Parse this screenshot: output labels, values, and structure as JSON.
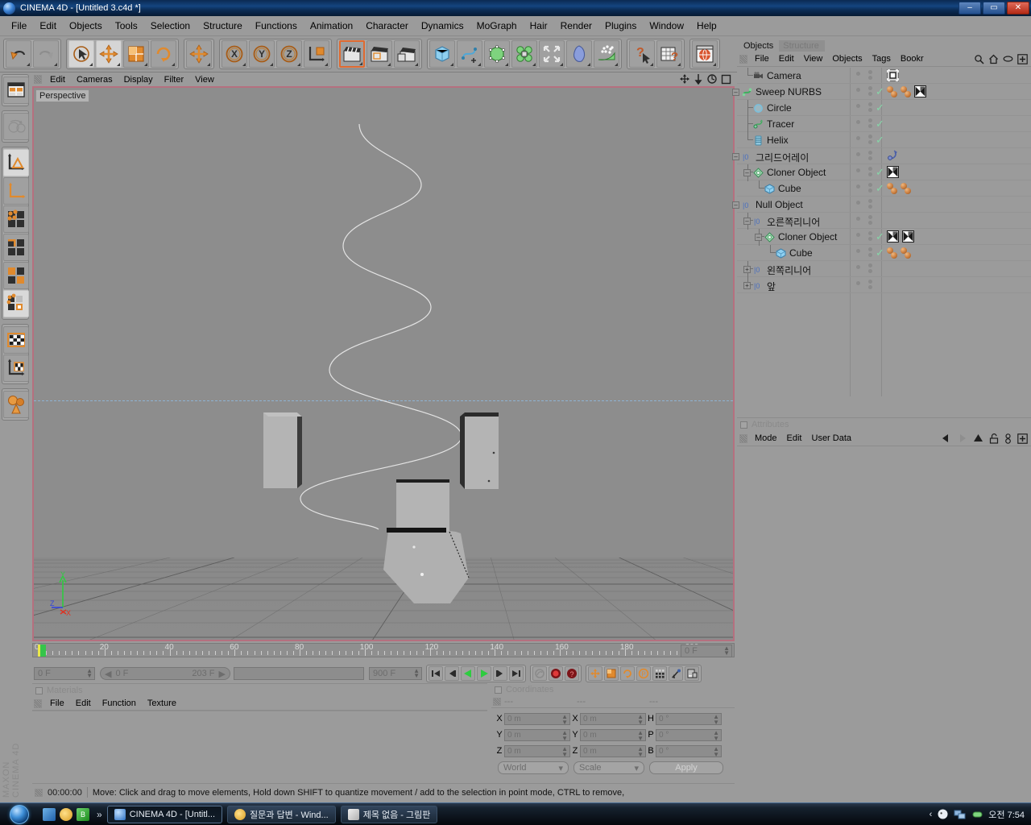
{
  "window": {
    "title": "CINEMA 4D - [Untitled 3.c4d *]",
    "minimize": "–",
    "maximize": "▭",
    "close": "✕"
  },
  "menubar": {
    "items": [
      "File",
      "Edit",
      "Objects",
      "Tools",
      "Selection",
      "Structure",
      "Functions",
      "Animation",
      "Character",
      "Dynamics",
      "MoGraph",
      "Hair",
      "Render",
      "Plugins",
      "Window",
      "Help"
    ]
  },
  "toolbar": {
    "groups": [
      {
        "buttons": [
          {
            "name": "undo-button",
            "icon": "undo"
          },
          {
            "name": "redo-button",
            "icon": "redo"
          }
        ]
      },
      {
        "buttons": [
          {
            "name": "live-selection-tool",
            "icon": "select-cursor",
            "state": "selected"
          },
          {
            "name": "move-tool",
            "icon": "move-arrows",
            "state": "selected"
          },
          {
            "name": "scale-tool",
            "icon": "scale-box"
          },
          {
            "name": "rotate-tool",
            "icon": "rotate-arrows"
          }
        ]
      },
      {
        "buttons": [
          {
            "name": "world-object-axis-tool",
            "icon": "move-arrows"
          }
        ]
      },
      {
        "buttons": [
          {
            "name": "lock-x-axis-button",
            "icon": "axis-x",
            "label": "X"
          },
          {
            "name": "lock-y-axis-button",
            "icon": "axis-y",
            "label": "Y"
          },
          {
            "name": "lock-z-axis-button",
            "icon": "axis-z",
            "label": "Z"
          },
          {
            "name": "world-coordinate-system-button",
            "icon": "axis-cube"
          }
        ]
      },
      {
        "buttons": [
          {
            "name": "render-view-button",
            "icon": "clapper-orange",
            "state": "highlight"
          },
          {
            "name": "render-region-button",
            "icon": "clapper-region"
          },
          {
            "name": "render-settings-button",
            "icon": "clapper-settings"
          }
        ]
      },
      {
        "buttons": [
          {
            "name": "add-cube-button",
            "icon": "cube-blue"
          },
          {
            "name": "add-spline-button",
            "icon": "spline"
          },
          {
            "name": "add-nurbs-button",
            "icon": "cube-green"
          },
          {
            "name": "add-modeling-object-button",
            "icon": "array-green"
          },
          {
            "name": "add-deformer-button",
            "icon": "deformer-arrows"
          },
          {
            "name": "add-scene-object-button",
            "icon": "environment-blob"
          },
          {
            "name": "add-particles-button",
            "icon": "particles"
          }
        ]
      },
      {
        "buttons": [
          {
            "name": "help-cursor-button",
            "icon": "question-cursor"
          },
          {
            "name": "content-browser-button",
            "icon": "table-question"
          }
        ]
      },
      {
        "buttons": [
          {
            "name": "web-button",
            "icon": "globe"
          }
        ]
      }
    ]
  },
  "left_toolbar": {
    "groups": [
      {
        "buttons": [
          {
            "name": "layout-presets-button",
            "icon": "layout-grid"
          }
        ]
      },
      {
        "buttons": [
          {
            "name": "world-grid-button",
            "icon": "world-globe"
          }
        ]
      },
      {
        "buttons": [
          {
            "name": "model-mode-button",
            "icon": "axis-triangle",
            "state": "selected"
          },
          {
            "name": "object-axis-mode-button",
            "icon": "axis-corner"
          },
          {
            "name": "points-mode-button",
            "icon": "points-grid"
          },
          {
            "name": "edges-mode-button",
            "icon": "edges-grid"
          },
          {
            "name": "polygons-mode-button",
            "icon": "polygons-grid"
          },
          {
            "name": "mograph-selection-mode-button",
            "icon": "mograph-grid",
            "state": "selected"
          }
        ]
      },
      {
        "buttons": [
          {
            "name": "texture-mode-button",
            "icon": "texture-checker"
          },
          {
            "name": "texture-axis-mode-button",
            "icon": "texture-axis"
          }
        ]
      },
      {
        "buttons": [
          {
            "name": "enable-axis-button",
            "icon": "axis-spheres"
          }
        ]
      }
    ],
    "brand_line_1": "MAXON",
    "brand_line_2": "CINEMA 4D"
  },
  "viewport": {
    "menu_items": [
      "Edit",
      "Cameras",
      "Display",
      "Filter",
      "View"
    ],
    "label": "Perspective",
    "header_icons": [
      "move-view-icon",
      "pan-view-icon",
      "rotate-view-icon",
      "maximize-view-icon"
    ],
    "axis_labels": {
      "x": "X",
      "y": "Y",
      "z": "Z"
    }
  },
  "timeline": {
    "ticks": [
      0,
      20,
      40,
      60,
      80,
      100,
      120,
      140,
      160,
      180,
      200
    ],
    "current_frame_display": "0 F",
    "start_field": "0 F",
    "range_start": "0 F",
    "range_end": "203 F",
    "end_field": "900 F",
    "transport_buttons": [
      {
        "name": "go-to-start-button",
        "icon": "skip-start"
      },
      {
        "name": "previous-frame-button",
        "icon": "step-back"
      },
      {
        "name": "play-backwards-button",
        "icon": "play-back"
      },
      {
        "name": "play-forwards-button",
        "icon": "play-forward"
      },
      {
        "name": "next-frame-button",
        "icon": "step-forward"
      },
      {
        "name": "go-to-end-button",
        "icon": "skip-end"
      }
    ],
    "record_buttons": [
      {
        "name": "autokeying-button",
        "icon": "key-gray"
      },
      {
        "name": "record-active-objects-button",
        "icon": "record-red"
      },
      {
        "name": "keyframe-selection-button",
        "icon": "key-question-red"
      }
    ],
    "key_toggle_buttons": [
      {
        "name": "record-position-button",
        "icon": "move-key"
      },
      {
        "name": "record-scale-button",
        "icon": "scale-key"
      },
      {
        "name": "record-rotation-button",
        "icon": "rotate-key"
      },
      {
        "name": "record-parameter-button",
        "icon": "param-key"
      },
      {
        "name": "record-pla-button",
        "icon": "pla-key"
      },
      {
        "name": "autokeying-toggle-button",
        "icon": "autokey"
      },
      {
        "name": "keyframe-settings-button",
        "icon": "key-settings"
      }
    ]
  },
  "materials": {
    "panel_title": "Materials",
    "menu_items": [
      "File",
      "Edit",
      "Function",
      "Texture"
    ]
  },
  "coordinates": {
    "panel_title": "Coordinates",
    "dash_headers": [
      "---",
      "---",
      "---"
    ],
    "rows": [
      {
        "pos_label": "X",
        "pos_value": "0 m",
        "size_label": "X",
        "size_value": "0 m",
        "rot_label": "H",
        "rot_value": "0 °"
      },
      {
        "pos_label": "Y",
        "pos_value": "0 m",
        "size_label": "Y",
        "size_value": "0 m",
        "rot_label": "P",
        "rot_value": "0 °"
      },
      {
        "pos_label": "Z",
        "pos_value": "0 m",
        "size_label": "Z",
        "size_value": "0 m",
        "rot_label": "B",
        "rot_value": "0 °"
      }
    ],
    "system_dropdown": "World",
    "mode_dropdown": "Scale",
    "apply_button": "Apply"
  },
  "statusbar": {
    "time": "00:00:00",
    "message": "Move: Click and drag to move elements, Hold down SHIFT to quantize movement / add to the selection in point mode, CTRL to remove,"
  },
  "object_manager": {
    "tabs": [
      {
        "label": "Objects",
        "active": true
      },
      {
        "label": "Structure",
        "active": false
      }
    ],
    "menu_items": [
      "File",
      "Edit",
      "View",
      "Objects",
      "Tags",
      "Bookr"
    ],
    "menu_icons": [
      "search-icon",
      "home-icon",
      "eye-icon",
      "plus-box-icon"
    ],
    "tree": [
      {
        "label": "Camera",
        "icon": "camera-icon",
        "depth": 1,
        "expander": "none",
        "visible_dots": 2,
        "check": false,
        "tags": [
          "camera-target-tag"
        ]
      },
      {
        "label": "Sweep NURBS",
        "icon": "sweep-nurbs-icon",
        "depth": 0,
        "expander": "minus",
        "visible_dots": 2,
        "check": true,
        "tags": [
          "material-tag",
          "material-tag",
          "mograph-tag"
        ]
      },
      {
        "label": "Circle",
        "icon": "circle-spline-icon",
        "depth": 1,
        "expander": "none",
        "visible_dots": 2,
        "check": true,
        "tags": []
      },
      {
        "label": "Tracer",
        "icon": "tracer-icon",
        "depth": 1,
        "expander": "none",
        "visible_dots": 2,
        "check": true,
        "tags": []
      },
      {
        "label": "Helix",
        "icon": "helix-icon",
        "depth": 1,
        "expander": "none",
        "visible_dots": 2,
        "check": true,
        "tags": []
      },
      {
        "label": "그리드어레이",
        "icon": "null-object-icon",
        "depth": 0,
        "expander": "minus",
        "visible_dots": 2,
        "check": false,
        "tags": [
          "dynamics-tag"
        ]
      },
      {
        "label": "Cloner Object",
        "icon": "cloner-icon",
        "depth": 1,
        "expander": "minus",
        "visible_dots": 2,
        "check": true,
        "tags": [
          "mograph-tag"
        ]
      },
      {
        "label": "Cube",
        "icon": "cube-icon",
        "depth": 2,
        "expander": "none",
        "visible_dots": 2,
        "check": true,
        "tags": [
          "material-tag",
          "material-tag"
        ]
      },
      {
        "label": "Null Object",
        "icon": "null-object-icon",
        "depth": 0,
        "expander": "minus",
        "visible_dots": 2,
        "check": false,
        "tags": []
      },
      {
        "label": "오른쪽리니어",
        "icon": "null-object-icon",
        "depth": 1,
        "expander": "minus",
        "visible_dots": 2,
        "check": false,
        "tags": []
      },
      {
        "label": "Cloner Object",
        "icon": "cloner-icon",
        "depth": 2,
        "expander": "minus",
        "visible_dots": 2,
        "check": true,
        "tags": [
          "mograph-tag",
          "mograph-tag"
        ]
      },
      {
        "label": "Cube",
        "icon": "cube-icon",
        "depth": 3,
        "expander": "none",
        "visible_dots": 2,
        "check": true,
        "tags": [
          "material-tag",
          "material-tag"
        ]
      },
      {
        "label": "왼쪽리니어",
        "icon": "null-object-icon",
        "depth": 1,
        "expander": "plus",
        "visible_dots": 2,
        "check": false,
        "tags": []
      },
      {
        "label": "앞",
        "icon": "null-object-icon",
        "depth": 1,
        "expander": "plus",
        "visible_dots": 2,
        "check": false,
        "tags": []
      }
    ]
  },
  "attributes": {
    "panel_title": "Attributes",
    "menu_items": [
      "Mode",
      "Edit",
      "User Data"
    ],
    "icons": [
      "back-arrow-icon",
      "forward-arrow-icon",
      "up-arrow-icon",
      "lock-icon",
      "link-icon",
      "plus-box-icon"
    ]
  },
  "taskbar": {
    "quick_launch": [
      "show-desktop-icon",
      "internet-explorer-icon",
      "bing-icon"
    ],
    "overflow": "»",
    "tasks": [
      {
        "label": "CINEMA 4D - [Untitl...",
        "icon": "c4d-icon",
        "active": true
      },
      {
        "label": "질문과 답변 - Wind...",
        "icon": "ie-icon",
        "active": false
      },
      {
        "label": "제목 없음 - 그림판",
        "icon": "paint-icon",
        "active": false
      }
    ],
    "tray_icons": [
      "chevron-left-icon",
      "speaker-icon",
      "network-icon",
      "pill-icon"
    ],
    "clock": "오전 7:54"
  },
  "colors": {
    "panel_bg": "#9b9b9b",
    "viewport_bg": "#8d8d8d",
    "viewport_border": "#b5707f",
    "accent_orange": "#e06a30",
    "check_green": "#86d6a8",
    "title_blue": "#14457f"
  }
}
